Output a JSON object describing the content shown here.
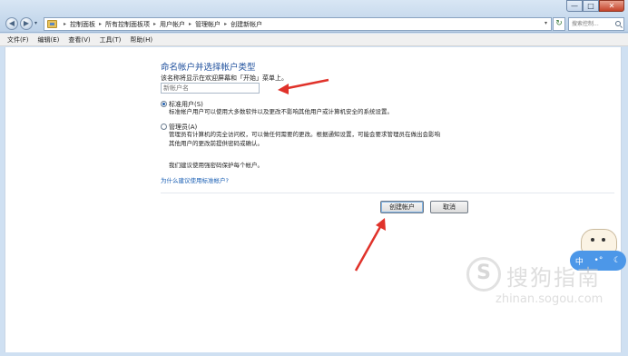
{
  "window": {
    "breadcrumbs": [
      "控制面板",
      "所有控制面板项",
      "用户帐户",
      "管理帐户",
      "创建新帐户"
    ],
    "search_placeholder": "搜索控制...",
    "controls": {
      "minimize": "—",
      "maximize": "□",
      "close": "✕"
    },
    "nav": {
      "back": "◀",
      "forward": "▶",
      "dropdown": "▾",
      "refresh": "↻",
      "address_dropdown": "▾"
    }
  },
  "menu": [
    "文件(F)",
    "编辑(E)",
    "查看(V)",
    "工具(T)",
    "帮助(H)"
  ],
  "main": {
    "title": "命名帐户并选择帐户类型",
    "instruction": "该名称将显示在欢迎屏幕和「开始」菜单上。",
    "name_placeholder": "新帐户名",
    "options": [
      {
        "label": "标准用户(S)",
        "checked": true,
        "desc": [
          "标准帐户用户可以使用大多数软件以及更改不影响其他用户或计算机安全的系统设置。"
        ]
      },
      {
        "label": "管理员(A)",
        "checked": false,
        "desc": [
          "管理员有计算机的完全访问权，可以做任何需要的更改。根据通知设置，可能会要求管理员在做出会影响",
          "其他用户的更改前提供密码或确认。"
        ]
      }
    ],
    "recommendation": "我们建议使用强密码保护每个帐户。",
    "link": "为什么建议使用标准帐户?",
    "buttons": {
      "create": "创建帐户",
      "cancel": "取消"
    }
  },
  "overlay": {
    "arrow_color": "#e0322a",
    "widget": {
      "left_char": "中",
      "icon2": "•°",
      "icon3": "☾"
    },
    "watermark": {
      "logo": "S",
      "name": "搜狗指南",
      "url": "zhinan.sogou.com"
    }
  }
}
